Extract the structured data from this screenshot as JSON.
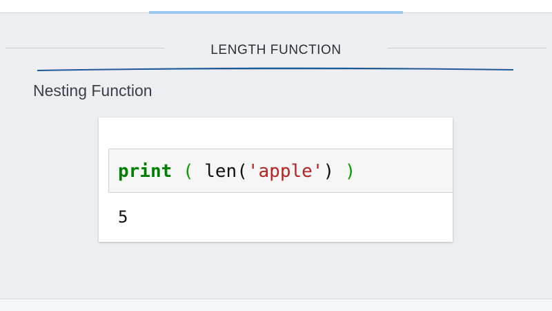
{
  "header": {
    "title": "LENGTH FUNCTION"
  },
  "content": {
    "subtitle": "Nesting Function",
    "code": {
      "keyword": "print",
      "space1": " ",
      "open_paren": "(",
      "space2": " ",
      "func": "len",
      "inner_open": "(",
      "string": "'apple'",
      "inner_close": ")",
      "space3": " ",
      "close_paren": ")"
    },
    "output": "5"
  },
  "colors": {
    "background": "#eceef2",
    "accent_bar": "#9cc7f0",
    "swoosh": "#1f5a96",
    "keyword": "#008000",
    "string": "#ba2121"
  }
}
